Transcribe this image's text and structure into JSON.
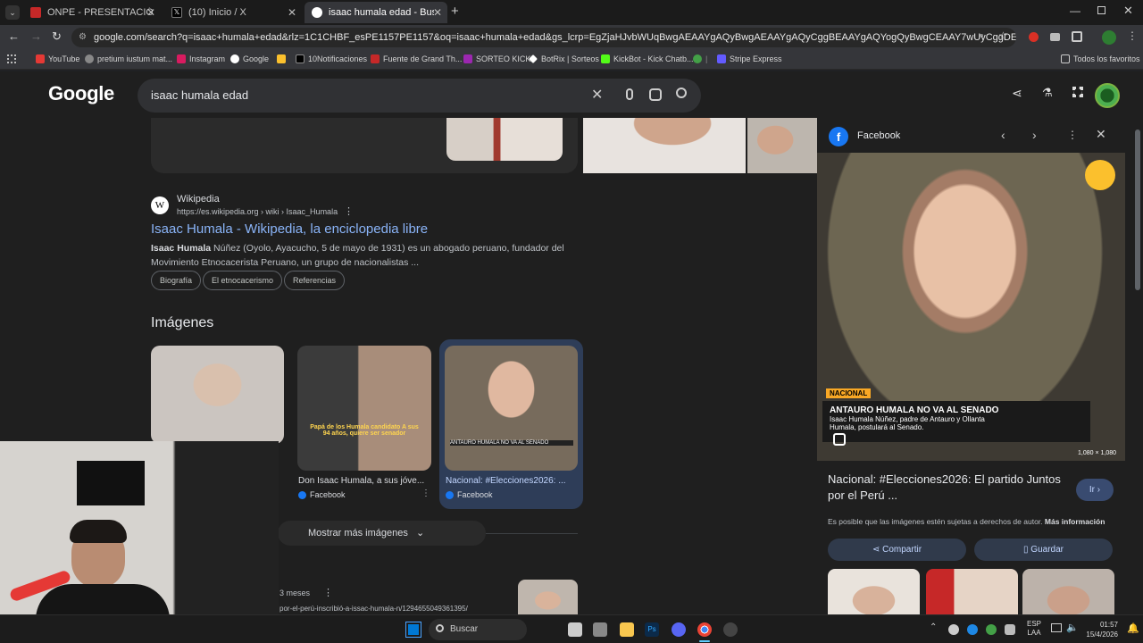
{
  "browser": {
    "tabs": [
      {
        "title": "ONPE - PRESENTACIÓN DE RE",
        "active": false
      },
      {
        "title": "(10) Inicio / X",
        "active": false
      },
      {
        "title": "isaac humala edad - Buscar co",
        "active": true
      }
    ],
    "url": "google.com/search?q=isaac+humala+edad&rlz=1C1CHBF_esPE1157PE1157&oq=isaac+humala+edad&gs_lcrp=EgZjaHJvbWUqBwgAEAAYgAQyBwgAEAAYgAQyCggBEAAYgAQYogQyBwgCEAAY7wUyCggDEAAYgAQYogTSAQgyNDIzajBqN...",
    "bookmarks": [
      "YouTube",
      "pretium iustum mat...",
      "Instagram",
      "Google",
      "10Notificaciones",
      "Fuente de Grand Th...",
      "SORTEO KICK",
      "BotRix | Sorteos",
      "KickBot - Kick Chatb...",
      "Stripe Express"
    ],
    "all_bookmarks": "Todos los favoritos"
  },
  "search": {
    "logo": "Google",
    "query": "isaac humala edad"
  },
  "result": {
    "site": "Wikipedia",
    "path": "https://es.wikipedia.org › wiki › Isaac_Humala",
    "title": "Isaac Humala - Wikipedia, la enciclopedia libre",
    "snippet_bold": "Isaac Humala",
    "snippet_line1": " Núñez (Oyolo, Ayacucho, 5 de mayo de 1931) es un abogado peruano, fundador del",
    "snippet_line2": "Movimiento Etnocacerista Peruano, un grupo de nacionalistas ...",
    "chips": [
      "Biografía",
      "El etnocacerismo",
      "Referencias"
    ]
  },
  "images": {
    "heading": "Imágenes",
    "items": [
      {
        "caption": "Don Isaac Humala, a sus jóve...",
        "source": "Facebook",
        "overlay": "Papá de los Humala candidato A sus 94 años, quiere ser senador"
      },
      {
        "caption": "Nacional: #Elecciones2026: ...",
        "source": "Facebook",
        "overlay": "ANTAURO HUMALA NO VA AL SENADO"
      }
    ],
    "more": "Mostrar más imágenes"
  },
  "lower": {
    "time": "3 meses",
    "url": "por-el-perú-inscribió-a-issac-humala-n/1294655049361395/"
  },
  "panel": {
    "source": "Facebook",
    "tag": "NACIONAL",
    "headline": "ANTAURO HUMALA NO VA AL SENADO",
    "sub1": "Isaac Humala Núñez, padre de Antauro y Ollanta",
    "sub2": "Humala, postulará al Senado.",
    "dims": "1,080 × 1,080",
    "title": "Nacional: #Elecciones2026: El partido Juntos por el Perú ...",
    "go": "Ir",
    "copyright": "Es posible que las imágenes estén sujetas a derechos de autor.",
    "more_info": "Más información",
    "share": "Compartir",
    "save": "Guardar"
  },
  "taskbar": {
    "search": "Buscar",
    "lang": "ESP",
    "lang2": "LAA",
    "time": "01:57",
    "date": "15/4/2026"
  }
}
